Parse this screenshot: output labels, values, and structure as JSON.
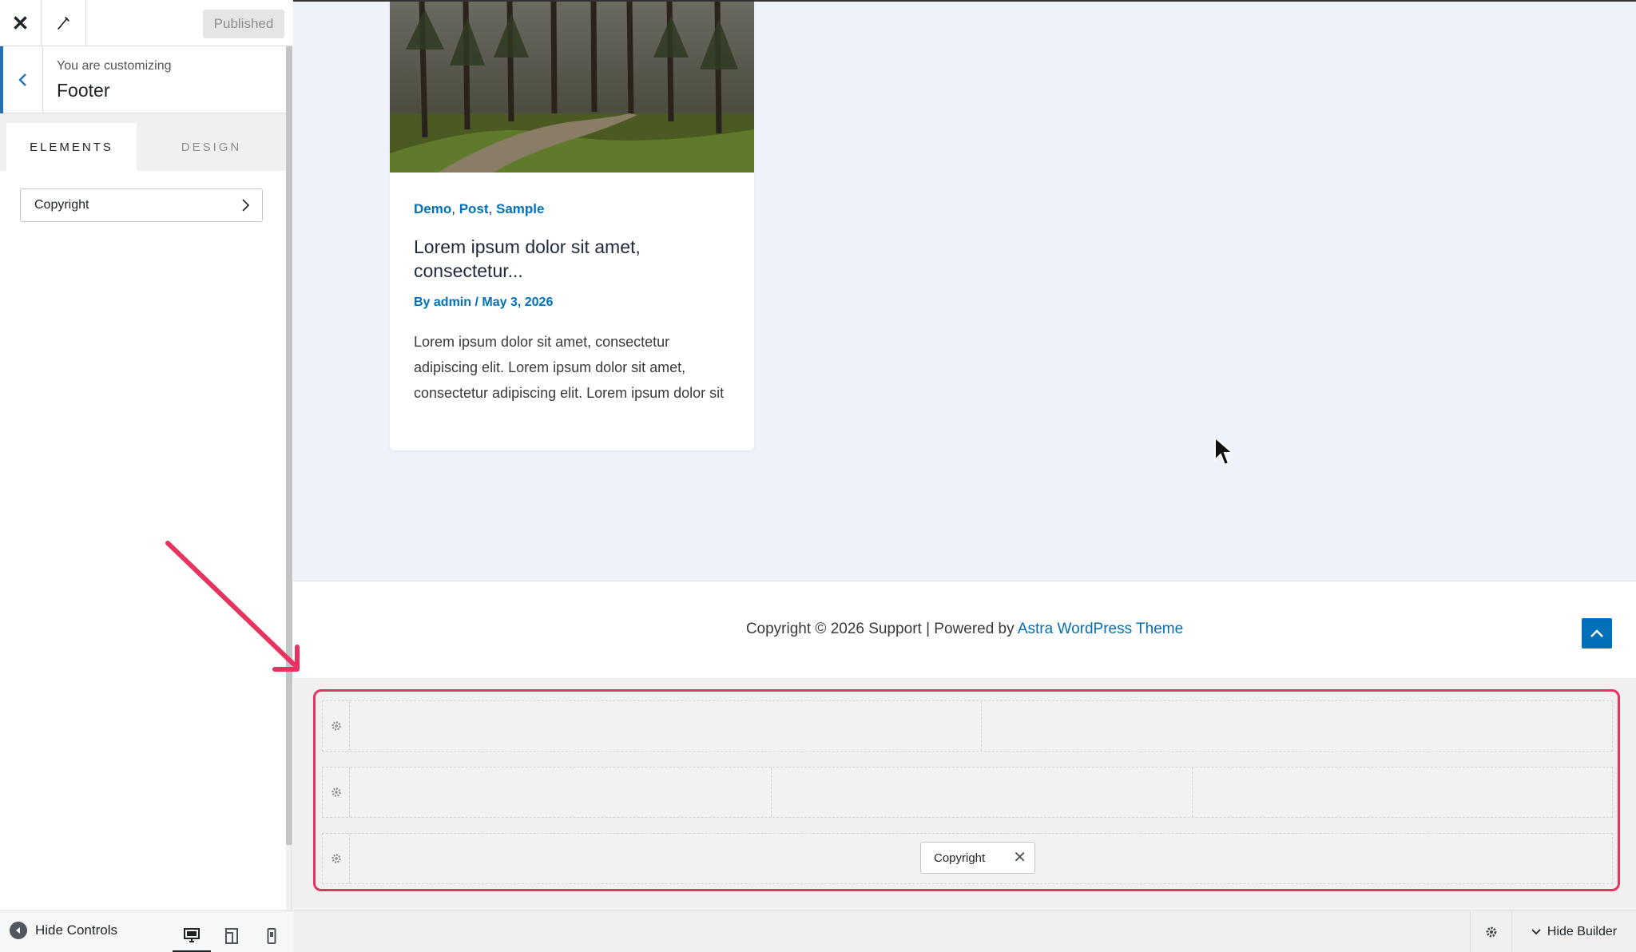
{
  "topbar": {
    "publish_label": "Published"
  },
  "customizer": {
    "label": "You are customizing",
    "section_title": "Footer"
  },
  "tabs": [
    {
      "label": "ELEMENTS",
      "active": true
    },
    {
      "label": "DESIGN",
      "active": false
    }
  ],
  "panel": {
    "items": [
      {
        "label": "Copyright"
      }
    ]
  },
  "sidebar_footer": {
    "hide_controls_label": "Hide Controls",
    "devices": [
      "desktop-icon",
      "tablet-icon",
      "mobile-icon"
    ],
    "active_device": "desktop"
  },
  "post_card": {
    "categories": [
      "Demo",
      "Post",
      "Sample"
    ],
    "category_sep": ",",
    "title": "Lorem ipsum dolor sit amet, consectetur...",
    "meta_prefix": "By",
    "meta_author": "admin",
    "meta_sep": "/",
    "meta_date": "May 3, 2026",
    "excerpt": "Lorem ipsum dolor sit amet, consectetur adipiscing elit. Lorem ipsum dolor sit amet, consectetur adipiscing elit. Lorem ipsum dolor sit"
  },
  "site_footer": {
    "copyright_text": "Copyright © 2026 Support | Powered by",
    "theme_link": "Astra WordPress Theme"
  },
  "builder": {
    "rows": [
      {
        "columns": 2,
        "items": []
      },
      {
        "columns": 3,
        "items": []
      },
      {
        "columns": 1,
        "items": [
          "Copyright"
        ]
      }
    ],
    "chip_label": "Copyright",
    "hide_builder_label": "Hide Builder"
  },
  "colors": {
    "accent": "#2271b1",
    "link": "#0170b9",
    "highlight": "#e6335f",
    "preview_bg": "#eef2fa"
  }
}
